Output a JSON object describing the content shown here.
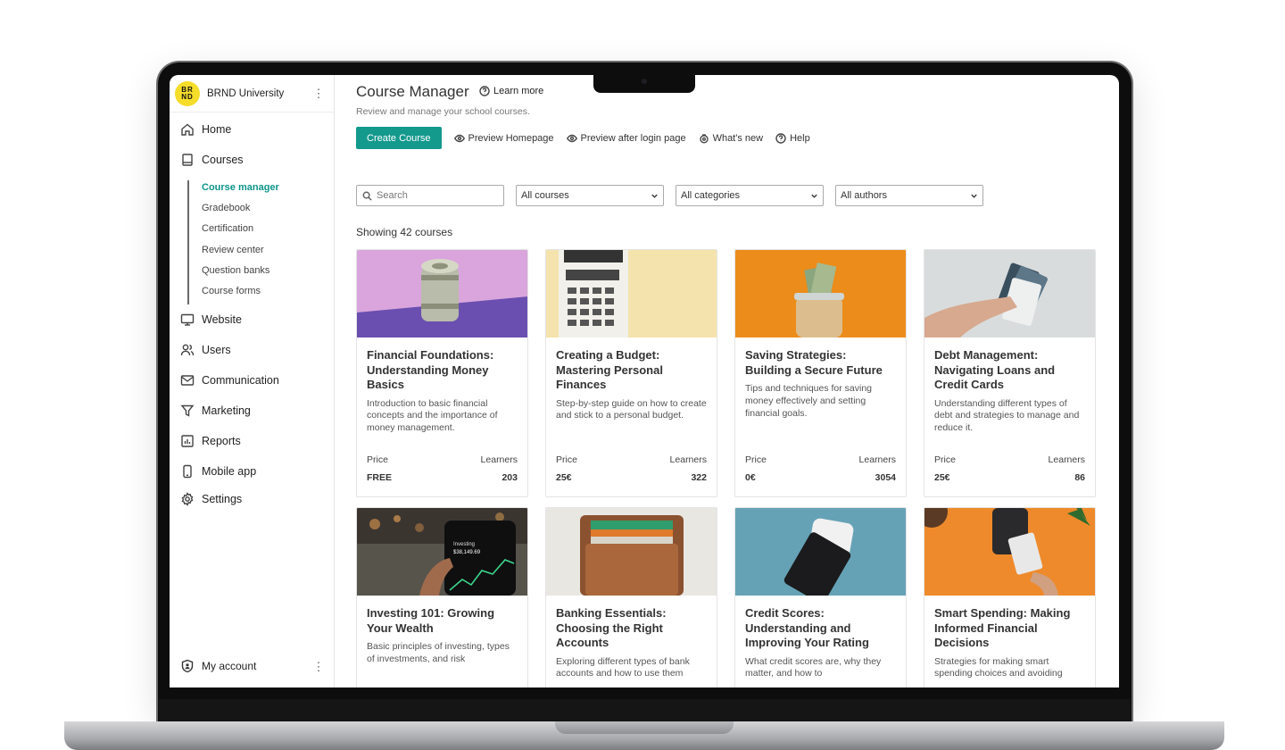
{
  "brand": {
    "logo_text": "BR ND",
    "name": "BRND University"
  },
  "sidebar": {
    "items": [
      {
        "label": "Home",
        "icon": "home-icon"
      },
      {
        "label": "Courses",
        "icon": "book-icon"
      },
      {
        "label": "Website",
        "icon": "monitor-icon"
      },
      {
        "label": "Users",
        "icon": "users-icon"
      },
      {
        "label": "Communication",
        "icon": "mail-icon"
      },
      {
        "label": "Marketing",
        "icon": "filter-icon"
      },
      {
        "label": "Reports",
        "icon": "bar-chart-icon"
      },
      {
        "label": "Mobile app",
        "icon": "phone-icon"
      },
      {
        "label": "Settings",
        "icon": "gear-icon"
      }
    ],
    "subitems": [
      "Course manager",
      "Gradebook",
      "Certification",
      "Review center",
      "Question banks",
      "Course forms"
    ],
    "active_subitem": "Course manager",
    "account_label": "My account"
  },
  "header": {
    "title": "Course Manager",
    "learn_more": "Learn more",
    "subtitle": "Review and manage your school courses."
  },
  "toolbar": {
    "create_label": "Create Course",
    "preview_home": "Preview Homepage",
    "preview_login": "Preview after login page",
    "whats_new": "What's new",
    "help": "Help"
  },
  "filters": {
    "search_placeholder": "Search",
    "courses": "All courses",
    "categories": "All categories",
    "authors": "All authors"
  },
  "showing": "Showing 42 courses",
  "labels": {
    "price": "Price",
    "learners": "Learners"
  },
  "courses": [
    {
      "title": "Financial Foundations: Understanding Money Basics",
      "desc": "Introduction to basic financial concepts and the importance of money management.",
      "price": "FREE",
      "learners": "203"
    },
    {
      "title": "Creating a Budget: Mastering Personal Finances",
      "desc": "Step-by-step guide on how to create and stick to a personal budget.",
      "price": "25€",
      "learners": "322"
    },
    {
      "title": "Saving Strategies: Building a Secure Future",
      "desc": "Tips and techniques for saving money effectively and setting financial goals.",
      "price": "0€",
      "learners": "3054"
    },
    {
      "title": "Debt Management: Navigating Loans and Credit Cards",
      "desc": "Understanding different types of debt and strategies to manage and reduce it.",
      "price": "25€",
      "learners": "86"
    },
    {
      "title": "Investing 101: Growing Your Wealth",
      "desc": "Basic principles of investing, types of investments, and risk",
      "price": "",
      "learners": "",
      "phone_label": "Investing",
      "phone_value": "$38,149.69"
    },
    {
      "title": "Banking Essentials: Choosing the Right Accounts",
      "desc": "Exploring different types of bank accounts and how to use them",
      "price": "",
      "learners": ""
    },
    {
      "title": "Credit Scores: Understanding and Improving Your Rating",
      "desc": "What credit scores are, why they matter, and how to",
      "price": "",
      "learners": ""
    },
    {
      "title": "Smart Spending: Making Informed Financial Decisions",
      "desc": "Strategies for making smart spending choices and avoiding",
      "price": "",
      "learners": ""
    }
  ],
  "colors": {
    "accent": "#14998d",
    "logo": "#f5dd2a"
  }
}
